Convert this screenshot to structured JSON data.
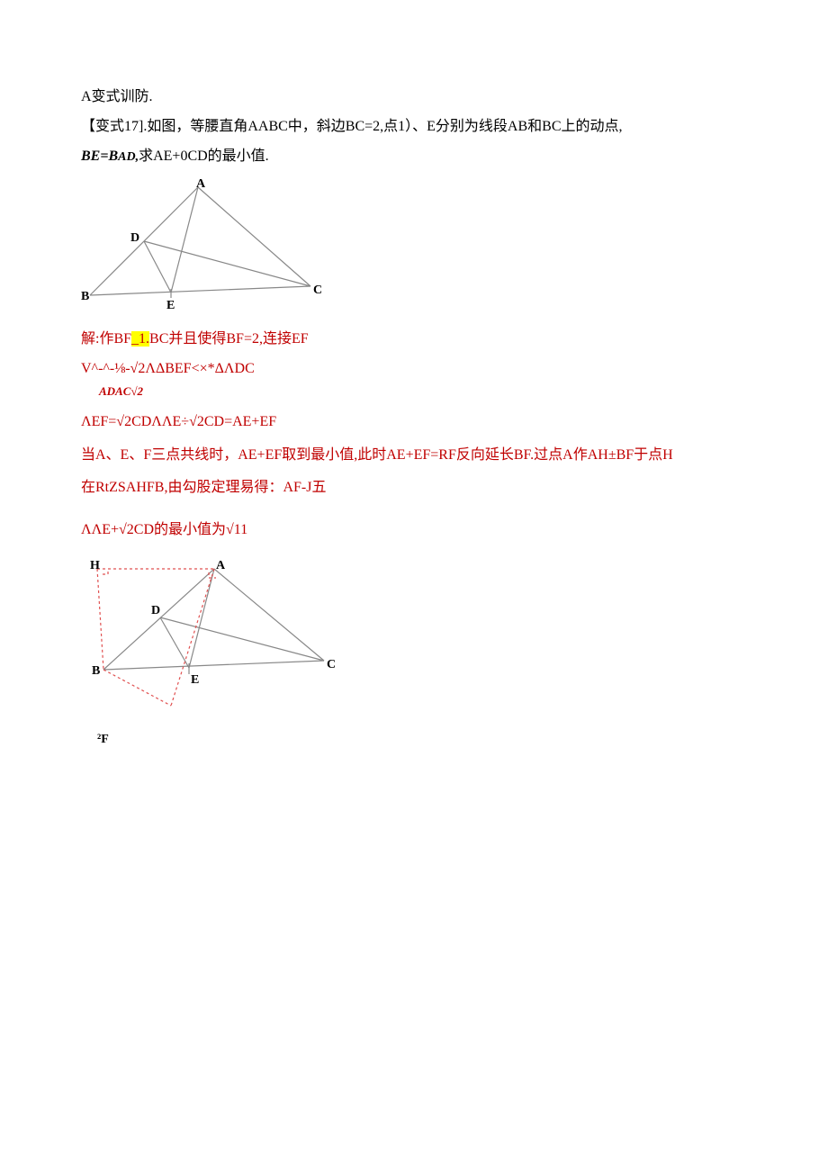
{
  "line1": "A变式训防.",
  "line2_a": "【变式17].如图，等腰直角AABC中，斜边BC=2,点1）、E分别为线段AB和BC上的动点,",
  "line2_b_italic": "BE=B",
  "line2_b_italic2": "AD,",
  "line2_b_tail": "求AE+0CD的最小值.",
  "fig1_labels": {
    "A": "A",
    "B": "B",
    "C": "C",
    "D": "D",
    "E": "E"
  },
  "sol1_a": "解:作BF",
  "sol1_hl": "_1.",
  "sol1_b": "BC并且使得BF=2,连接EF",
  "sol2": "V^-^-⅛-√2ΛΔBEF<×*ΔΛDC",
  "sol2_sub": "ADAC√2",
  "sol3": "ΛEF=√2CDΛΛE÷√2CD=AE+EF",
  "sol4": "当A、E、F三点共线时，AE+EF取到最小值,此时AE+EF=RF反向延长BF.过点A作AH±BF于点H",
  "sol5": "在RtZSAHFB,由勾股定理易得：AF-J五",
  "sol6": "ΛΛE+√2CD的最小值为√11",
  "fig2_labels": {
    "H": "H",
    "A": "A",
    "B": "B",
    "C": "C",
    "D": "D",
    "E": "E",
    "F": "²F"
  }
}
